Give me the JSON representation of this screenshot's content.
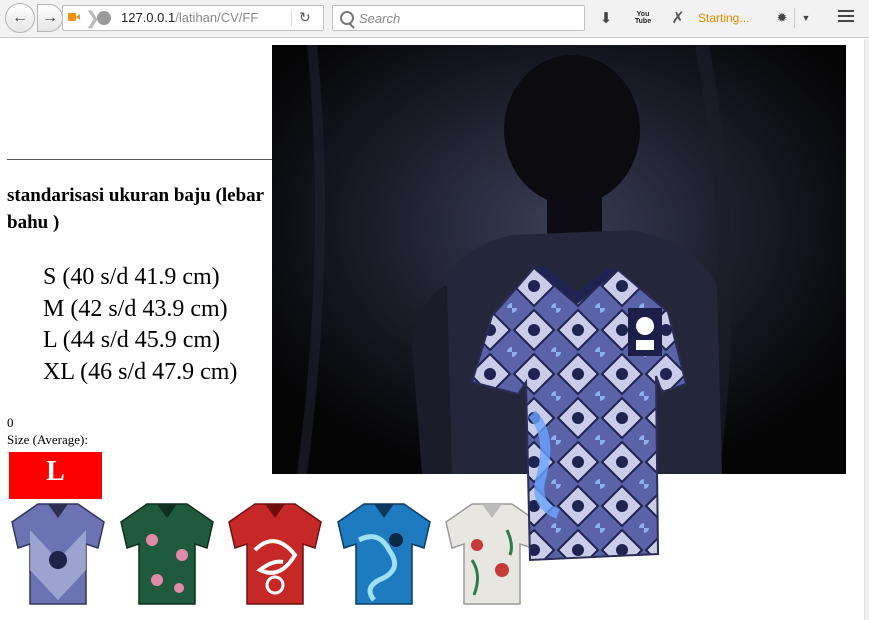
{
  "browser": {
    "url_host": "127.0.0.1",
    "url_path": "/latihan/CV/FF",
    "search_placeholder": "Search",
    "youtube_label": "You Tube",
    "status_text": "Starting...",
    "icons": [
      "back-arrow-icon",
      "forward-arrow-icon",
      "camera-icon",
      "globe-icon",
      "reload-icon",
      "search-icon",
      "download-icon",
      "youtube-icon",
      "x-extension-icon",
      "extension-icon",
      "dropdown-icon",
      "menu-icon"
    ]
  },
  "content": {
    "heading": "standarisasi ukuran baju (lebar bahu )",
    "sizes": [
      "S (40 s/d 41.9 cm)",
      "M (42 s/d 43.9 cm)",
      "L (44 s/d 45.9 cm)",
      "XL (46 s/d 47.9 cm)"
    ],
    "counter": "0",
    "average_label": "Size (Average):",
    "average_size": "L"
  },
  "colors": {
    "size_box": "#ff0000",
    "status_text": "#e58a00",
    "shirt_thumbs": [
      "#6b73b3",
      "#1f5a3c",
      "#c62828",
      "#1e7bbf",
      "#e8e6e0"
    ]
  },
  "shirts": [
    {
      "name": "blue-batik-shirt"
    },
    {
      "name": "green-batik-shirt"
    },
    {
      "name": "red-batik-shirt"
    },
    {
      "name": "turquoise-batik-shirt"
    },
    {
      "name": "white-floral-batik-shirt"
    }
  ]
}
